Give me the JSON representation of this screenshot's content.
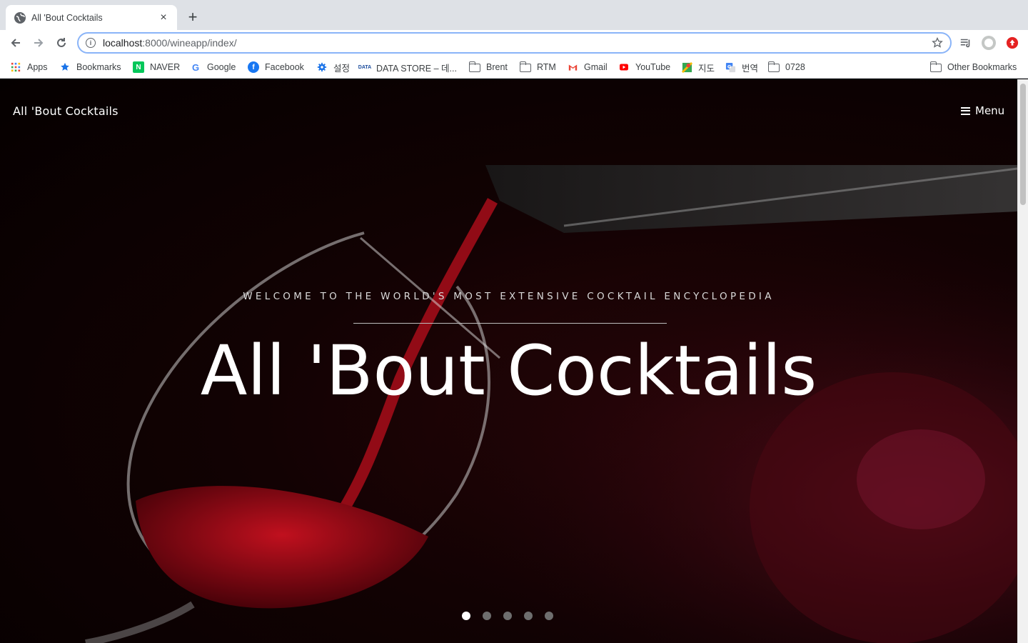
{
  "browser": {
    "tab_title": "All 'Bout Cocktails",
    "tab_close": "×",
    "new_tab": "+",
    "url_host": "localhost",
    "url_path": ":8000/wineapp/index/"
  },
  "bookmarks": [
    {
      "label": "Apps",
      "icon": "apps-grid-icon"
    },
    {
      "label": "Bookmarks",
      "icon": "star-icon"
    },
    {
      "label": "NAVER",
      "icon": "naver-icon"
    },
    {
      "label": "Google",
      "icon": "google-icon"
    },
    {
      "label": "Facebook",
      "icon": "facebook-icon"
    },
    {
      "label": "설정",
      "icon": "settings-gear-icon"
    },
    {
      "label": "DATA STORE – 데...",
      "icon": "data-store-icon"
    },
    {
      "label": "Brent",
      "icon": "folder-icon"
    },
    {
      "label": "RTM",
      "icon": "folder-icon"
    },
    {
      "label": "Gmail",
      "icon": "gmail-icon"
    },
    {
      "label": "YouTube",
      "icon": "youtube-icon"
    },
    {
      "label": "지도",
      "icon": "maps-icon"
    },
    {
      "label": "번역",
      "icon": "translate-icon"
    },
    {
      "label": "0728",
      "icon": "folder-icon"
    },
    {
      "label": "Other Bookmarks",
      "icon": "folder-icon"
    }
  ],
  "site": {
    "logo": "All 'Bout Cocktails",
    "menu_label": "Menu",
    "hero_subtitle": "WELCOME TO THE WORLD'S MOST EXTENSIVE COCKTAIL ENCYCLOPEDIA",
    "hero_title": "All 'Bout Cocktails",
    "slides_total": 5,
    "slide_active": 1
  },
  "colors": {
    "wine": "#8b0a14",
    "accent_omnibox": "#8ab4f8"
  }
}
